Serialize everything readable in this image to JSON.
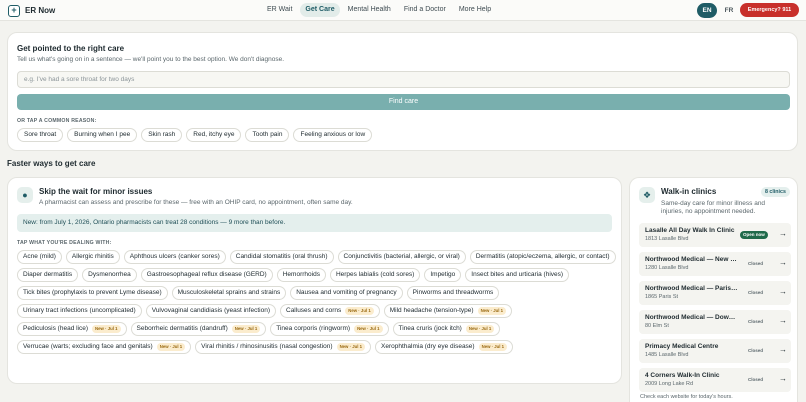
{
  "app": {
    "name": "ER Now"
  },
  "nav": [
    {
      "label": "ER Wait",
      "active": false
    },
    {
      "label": "Get Care",
      "active": true
    },
    {
      "label": "Mental Health",
      "active": false
    },
    {
      "label": "Find a Doctor",
      "active": false
    },
    {
      "label": "More Help",
      "active": false
    }
  ],
  "lang": {
    "en": "EN",
    "fr": "FR"
  },
  "emergency": {
    "label": "Emergency? 911"
  },
  "hero": {
    "title": "Get pointed to the right care",
    "subtitle": "Tell us what's going on in a sentence — we'll point you to the best option. We don't diagnose.",
    "search_value": "",
    "search_placeholder": "e.g. I've had a sore throat for two days",
    "find_button": "Find care",
    "common_label": "OR TAP A COMMON REASON:",
    "reasons": [
      "Sore throat",
      "Burning when I pee",
      "Skin rash",
      "Red, itchy eye",
      "Tooth pain",
      "Feeling anxious or low"
    ]
  },
  "section_title": "Faster ways to get care",
  "minor": {
    "title": "Skip the wait for minor issues",
    "subtitle": "A pharmacist can assess and prescribe for these — free with an OHIP card, no appointment, often same day.",
    "notice": "New: from July 1, 2026, Ontario pharmacists can treat 28 conditions — 9 more than before.",
    "tap_label": "TAP WHAT YOU'RE DEALING WITH:",
    "new_badge": "New · Jul 1",
    "conditions": [
      {
        "label": "Acne (mild)",
        "is_new": false
      },
      {
        "label": "Allergic rhinitis",
        "is_new": false
      },
      {
        "label": "Aphthous ulcers (canker sores)",
        "is_new": false
      },
      {
        "label": "Candidal stomatitis (oral thrush)",
        "is_new": false
      },
      {
        "label": "Conjunctivitis (bacterial, allergic, or viral)",
        "is_new": false
      },
      {
        "label": "Dermatitis (atopic/eczema, allergic, or contact)",
        "is_new": false
      },
      {
        "label": "Diaper dermatitis",
        "is_new": false
      },
      {
        "label": "Dysmenorrhea",
        "is_new": false
      },
      {
        "label": "Gastroesophageal reflux disease (GERD)",
        "is_new": false
      },
      {
        "label": "Hemorrhoids",
        "is_new": false
      },
      {
        "label": "Herpes labialis (cold sores)",
        "is_new": false
      },
      {
        "label": "Impetigo",
        "is_new": false
      },
      {
        "label": "Insect bites and urticaria (hives)",
        "is_new": false
      },
      {
        "label": "Tick bites (prophylaxis to prevent Lyme disease)",
        "is_new": false
      },
      {
        "label": "Musculoskeletal sprains and strains",
        "is_new": false
      },
      {
        "label": "Nausea and vomiting of pregnancy",
        "is_new": false
      },
      {
        "label": "Pinworms and threadworms",
        "is_new": false
      },
      {
        "label": "Urinary tract infections (uncomplicated)",
        "is_new": false
      },
      {
        "label": "Vulvovaginal candidiasis (yeast infection)",
        "is_new": false
      },
      {
        "label": "Calluses and corns",
        "is_new": true
      },
      {
        "label": "Mild headache (tension-type)",
        "is_new": true
      },
      {
        "label": "Pediculosis (head lice)",
        "is_new": true
      },
      {
        "label": "Seborrheic dermatitis (dandruff)",
        "is_new": true
      },
      {
        "label": "Tinea corporis (ringworm)",
        "is_new": true
      },
      {
        "label": "Tinea cruris (jock itch)",
        "is_new": true
      },
      {
        "label": "Verrucae (warts; excluding face and genitals)",
        "is_new": true
      },
      {
        "label": "Viral rhinitis / rhinosinusitis (nasal congestion)",
        "is_new": true
      },
      {
        "label": "Xerophthalmia (dry eye disease)",
        "is_new": true
      }
    ]
  },
  "clinics": {
    "title": "Walk-in clinics",
    "count": "8 clinics",
    "subtitle": "Same-day care for minor illness and injuries, no appointment needed.",
    "items": [
      {
        "name": "Lasalle All Day Walk In Clinic",
        "address": "1813 Lasalle Blvd",
        "status": "Open now",
        "open": true
      },
      {
        "name": "Northwood Medical — New Sudbury",
        "address": "1280 Lasalle Blvd",
        "status": "Closed",
        "open": false
      },
      {
        "name": "Northwood Medical — Paris St.",
        "address": "1865 Paris St",
        "status": "Closed",
        "open": false
      },
      {
        "name": "Northwood Medical — Downtown",
        "address": "80 Elm St",
        "status": "Closed",
        "open": false
      },
      {
        "name": "Primacy Medical Centre",
        "address": "1485 Lasalle Blvd",
        "status": "Closed",
        "open": false
      },
      {
        "name": "4 Corners Walk-In Clinic",
        "address": "2009 Long Lake Rd",
        "status": "Closed",
        "open": false
      }
    ],
    "footer": "Check each website for today's hours."
  },
  "icons": {
    "logo": "plus-icon",
    "minor": "pill-icon",
    "clinics": "walking-person-icon",
    "row_arrow": "arrow-right-icon"
  },
  "colors": {
    "brand": "#1f5c66",
    "find_button": "#79afae",
    "emergency": "#c8302b",
    "open_status": "#1f6a4a",
    "new_badge_bg": "#fbeccd"
  }
}
